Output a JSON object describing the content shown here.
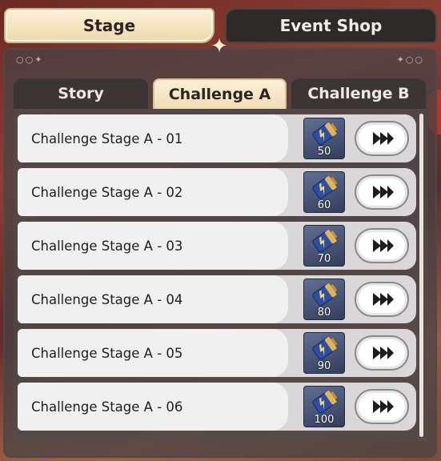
{
  "top_tabs": {
    "stage": "Stage",
    "event_shop": "Event Shop",
    "active": "Stage"
  },
  "sub_tabs": {
    "story": "Story",
    "challenge_a": "Challenge A",
    "challenge_b": "Challenge B",
    "active": "Challenge A"
  },
  "stages": [
    {
      "name": "Challenge Stage A - 01",
      "cost": "50"
    },
    {
      "name": "Challenge Stage A - 02",
      "cost": "60"
    },
    {
      "name": "Challenge Stage A - 03",
      "cost": "70"
    },
    {
      "name": "Challenge Stage A - 04",
      "cost": "80"
    },
    {
      "name": "Challenge Stage A - 05",
      "cost": "90"
    },
    {
      "name": "Challenge Stage A - 06",
      "cost": "100"
    }
  ],
  "icons": {
    "cost": "battery-icon",
    "go": "fast-forward-icon",
    "divider": "sparkle-icon"
  },
  "colors": {
    "active_tab": "#efd9ae",
    "inactive_tab": "#2d2a29",
    "row": "#f1f0f0",
    "battery": "#d9a84b"
  }
}
